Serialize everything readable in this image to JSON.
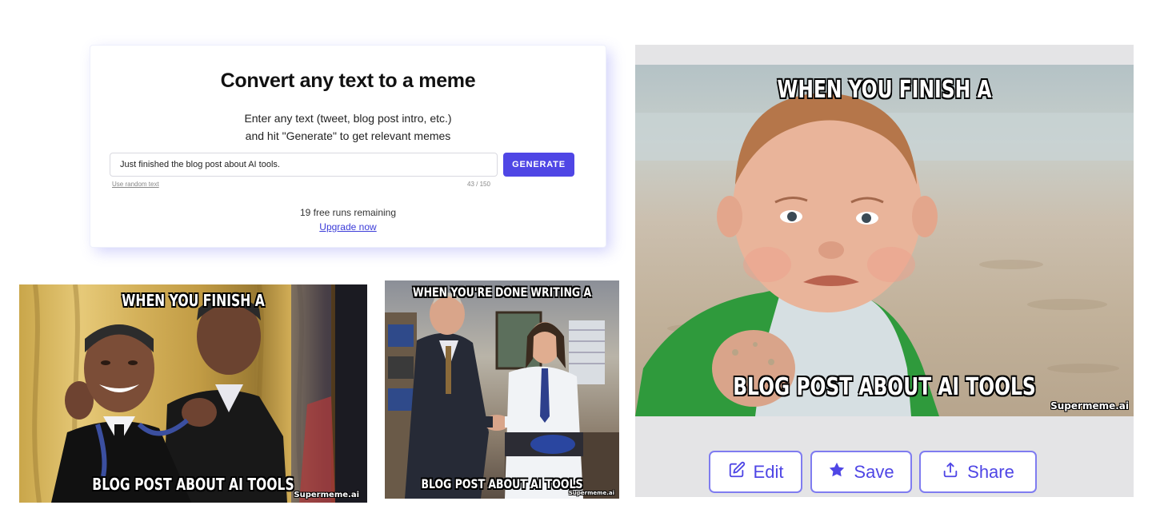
{
  "converter": {
    "title": "Convert any text to a meme",
    "description_line1": "Enter any text (tweet, blog post intro, etc.)",
    "description_line2": "and hit \"Generate\" to get relevant memes",
    "input_value": "Just finished the blog post about AI tools.",
    "generate_label": "GENERATE",
    "random_link": "Use random text",
    "char_counter": "43 / 150",
    "runs_remaining": "19 free runs remaining",
    "upgrade_link": "Upgrade now",
    "accent_color": "#4f46e5"
  },
  "memes": [
    {
      "top_text": "WHEN YOU FINISH A",
      "bottom_text": "BLOG POST ABOUT AI TOOLS",
      "watermark": "Supermeme.ai"
    },
    {
      "top_text": "WHEN YOU'RE DONE WRITING A",
      "bottom_text": "BLOG POST ABOUT AI TOOLS",
      "watermark": "Supermeme.ai"
    },
    {
      "top_text": "WHEN YOU FINISH A",
      "bottom_text": "BLOG POST ABOUT AI TOOLS",
      "watermark": "Supermeme.ai"
    }
  ],
  "actions": {
    "edit": {
      "label": "Edit",
      "icon": "pencil-square-icon"
    },
    "save": {
      "label": "Save",
      "icon": "star-icon"
    },
    "share": {
      "label": "Share",
      "icon": "upload-share-icon"
    }
  }
}
